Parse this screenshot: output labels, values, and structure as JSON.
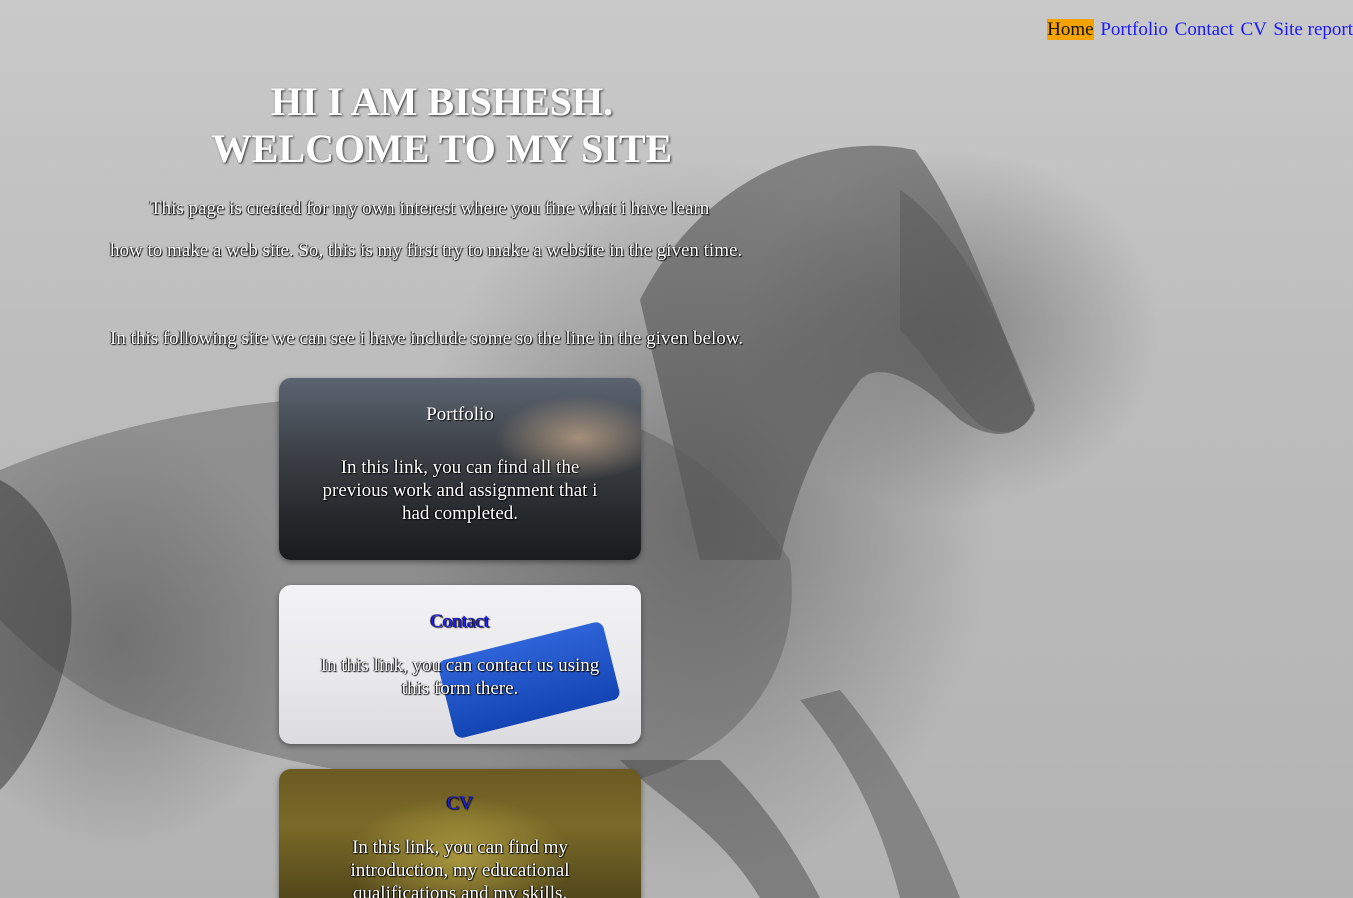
{
  "nav": {
    "items": [
      {
        "label": "Home",
        "active": true
      },
      {
        "label": "Portfolio",
        "active": false
      },
      {
        "label": "Contact",
        "active": false
      },
      {
        "label": "CV",
        "active": false
      },
      {
        "label": "Site report",
        "active": false
      }
    ]
  },
  "hero": {
    "line1": "HI I AM BISHESH.",
    "line2": "WELCOME TO MY SITE"
  },
  "intro": {
    "line1": "This page is created for my own interest where you fine what i have learn",
    "line2": "how to make a web site. So, this is my first try to make a website in the given time.",
    "line3": "In this following site we can see i have include some so the line in the given below."
  },
  "cards": {
    "portfolio": {
      "title": "Portfolio",
      "text": "In this link, you can find all the previous work and assignment that i had completed."
    },
    "contact": {
      "title": "Contact",
      "text": "In this link, you can contact us using this form there."
    },
    "cv": {
      "title": "CV",
      "text": "In this link, you can find my introduction, my educational qualifications and my skills."
    }
  },
  "colors": {
    "nav_link": "#1a1aff",
    "nav_active_bg": "#f5a300"
  }
}
